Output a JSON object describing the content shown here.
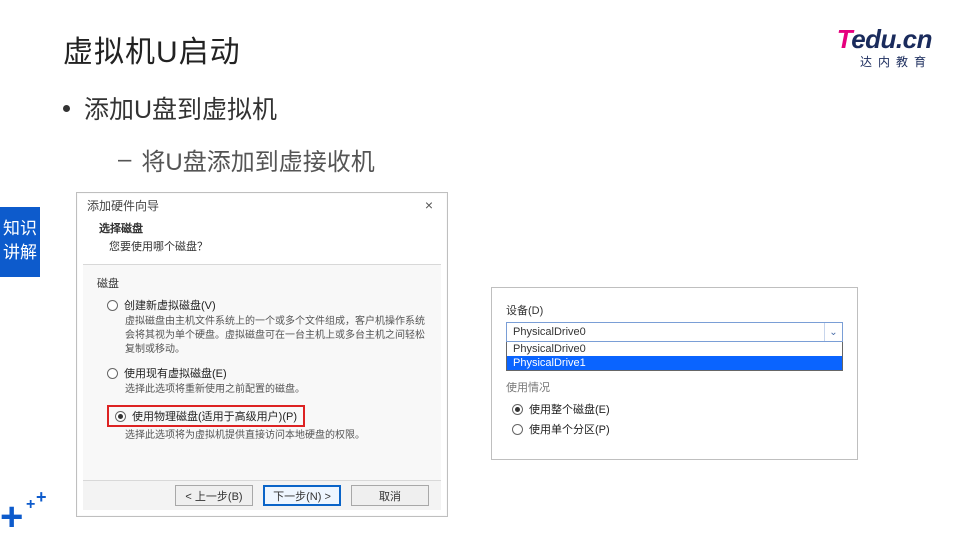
{
  "title": "虚拟机U启动",
  "logo": {
    "t": "T",
    "rest": "edu.cn",
    "sub": "达内教育"
  },
  "bullet": "添加U盘到虚拟机",
  "sub_bullet": "将U盘添加到虚接收机",
  "side_tag": "知识讲解",
  "dialog": {
    "window_title": "添加硬件向导",
    "close": "×",
    "head_title": "选择磁盘",
    "head_question": "您要使用哪个磁盘？",
    "section_label": "磁盘",
    "opt1": {
      "label": "创建新虚拟磁盘(V)",
      "desc": "虚拟磁盘由主机文件系统上的一个或多个文件组成，客户机操作系统会将其视为单个硬盘。虚拟磁盘可在一台主机上或多台主机之间轻松复制或移动。"
    },
    "opt2": {
      "label": "使用现有虚拟磁盘(E)",
      "desc": "选择此选项将重新使用之前配置的磁盘。"
    },
    "opt3": {
      "label": "使用物理磁盘(适用于高级用户)(P)",
      "desc": "选择此选项将为虚拟机提供直接访问本地硬盘的权限。"
    },
    "back": "< 上一步(B)",
    "next": "下一步(N) >",
    "cancel": "取消"
  },
  "panel": {
    "device_label": "设备(D)",
    "combo_value": "PhysicalDrive0",
    "options": [
      "PhysicalDrive0",
      "PhysicalDrive1"
    ],
    "usage_heading": "使用情况",
    "use_whole": "使用整个磁盘(E)",
    "use_partition": "使用单个分区(P)"
  }
}
